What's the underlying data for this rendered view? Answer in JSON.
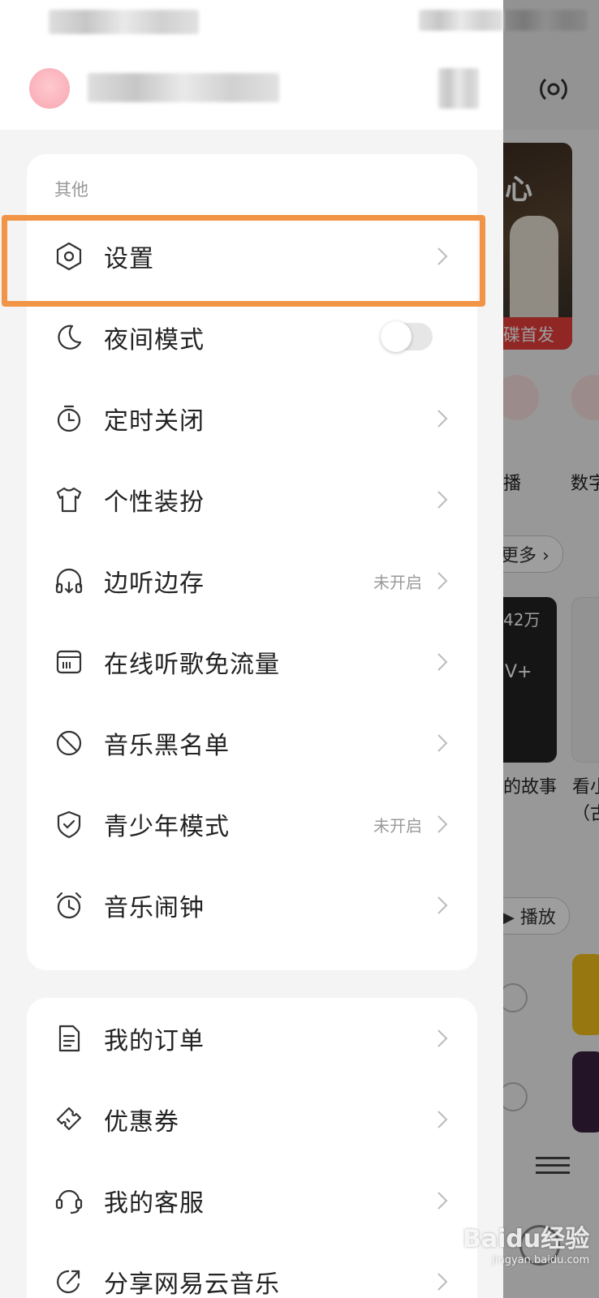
{
  "background_app": {
    "banner_partial_text": "心",
    "banner_caption": "碟首发",
    "icon_labels": [
      "播",
      "数字"
    ],
    "more_label": "更多",
    "playcount": "42万",
    "vplus": "V+",
    "story_text": "的故事",
    "watch_text": "看小",
    "paren_text": "（古",
    "play_label": "播放"
  },
  "drawer": {
    "section_other": {
      "title": "其他",
      "items": [
        {
          "icon": "gear-hexagon-icon",
          "label": "设置",
          "value": "",
          "control": "chevron"
        },
        {
          "icon": "moon-icon",
          "label": "夜间模式",
          "value": "",
          "control": "toggle",
          "toggle_on": false
        },
        {
          "icon": "timer-icon",
          "label": "定时关闭",
          "value": "",
          "control": "chevron"
        },
        {
          "icon": "tshirt-icon",
          "label": "个性装扮",
          "value": "",
          "control": "chevron"
        },
        {
          "icon": "headphones-download-icon",
          "label": "边听边存",
          "value": "未开启",
          "control": "chevron"
        },
        {
          "icon": "sim-card-icon",
          "label": "在线听歌免流量",
          "value": "",
          "control": "chevron"
        },
        {
          "icon": "block-icon",
          "label": "音乐黑名单",
          "value": "",
          "control": "chevron"
        },
        {
          "icon": "shield-check-icon",
          "label": "青少年模式",
          "value": "未开启",
          "control": "chevron"
        },
        {
          "icon": "alarm-clock-icon",
          "label": "音乐闹钟",
          "value": "",
          "control": "chevron"
        }
      ]
    },
    "section_account": {
      "items": [
        {
          "icon": "order-document-icon",
          "label": "我的订单",
          "value": "",
          "control": "chevron"
        },
        {
          "icon": "coupon-icon",
          "label": "优惠券",
          "value": "",
          "control": "chevron"
        },
        {
          "icon": "customer-service-icon",
          "label": "我的客服",
          "value": "",
          "control": "chevron"
        },
        {
          "icon": "share-icon",
          "label": "分享网易云音乐",
          "value": "",
          "control": "chevron"
        }
      ]
    }
  },
  "watermark": {
    "brand": "Baidu经验",
    "url": "jingyan.baidu.com"
  },
  "colors": {
    "highlight": "#f29446",
    "accent": "#e8403a"
  }
}
